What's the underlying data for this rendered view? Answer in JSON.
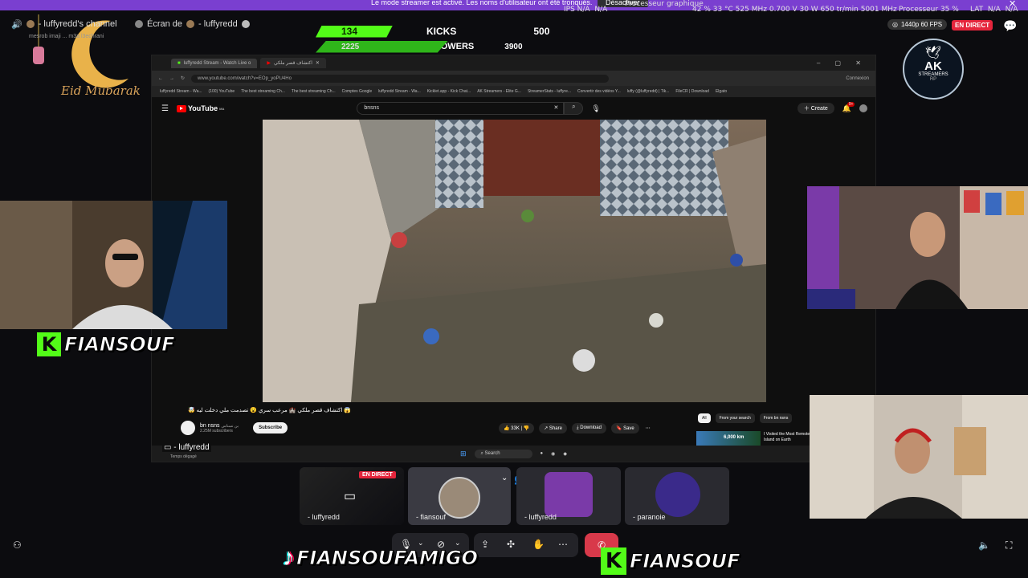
{
  "notice": {
    "message": "Le mode streamer est activé. Les noms d'utilisateur ont été tronqués.",
    "disable_label": "Désactiver",
    "extra": "Processeur graphique"
  },
  "stats": {
    "ips_label": "IPS",
    "ips1": "N/A",
    "ips2": "N/A",
    "gpu": "42 %  33 °C  525 MHz  0.700 V  30 W  650 tr/min  5001 MHz",
    "cpu": "Processeur  35 %",
    "lat_label": "LAT",
    "lat1": "N/A",
    "lat2": "N/A"
  },
  "overlay_left": {
    "channel": "- luffyredd's channel",
    "screen": "Écran de",
    "screen_user": "- luffyredd",
    "subtitle": "mesrob imaji   ... m3a l3echrani",
    "eid": "Eid Mubarak"
  },
  "counters": {
    "kicks_value": "134",
    "kicks_label": "KICKS",
    "kicks_goal": "500",
    "kicks_progress": 0.268,
    "followers_value": "2225",
    "followers_label": "FOLLOWERS",
    "followers_goal": "3900",
    "followers_progress": 0.57
  },
  "stream_status": {
    "quality": "1440p 60 FPS",
    "live_badge": "EN DIRECT"
  },
  "logo_ak": {
    "text1": "AK",
    "text2": "STREAMERS",
    "text3": "RP"
  },
  "browser": {
    "tab1": "luffyredd Stream - Watch Live o",
    "tab2": "اكتشاف قصر ملكي",
    "url": "www.youtube.com/watch?v=EOp_yoPU4Ho",
    "connexion": "Connexion",
    "bookmarks": [
      "luffyredd Stream - Wa...",
      "(100) YouTube",
      "The best streaming Ch...",
      "The best streaming Ch...",
      "Comptes Google",
      "luffyredd Stream - Wa...",
      "Kicklet.app - Kick Chat...",
      "AK Streamers - Elite G...",
      "StreamerStats - luffyre...",
      "Convertir des vidéos Y...",
      "luffy (@luffyredd) | Tik...",
      "FileCR | Download",
      "Elgato"
    ]
  },
  "youtube": {
    "brand": "YouTube",
    "region": "MA",
    "search": "bnsns",
    "create": "Create",
    "notif_count": "9+",
    "video_title": "😱 اكتشاف قصر ملكي 🏰 مرعب سري 😮 تصدمت ملي دخلت ليه 🤯",
    "channel": "bn nsns",
    "channel_ar": "بن نسناس",
    "subs": "2.25M subscribers",
    "subscribe": "Subscribe",
    "likes": "33K",
    "share": "Share",
    "download": "Download",
    "save": "Save",
    "chips": [
      "All",
      "From your search",
      "From bn nsns"
    ],
    "rec_title": "I Visited the Most Remote Island on Earth",
    "rec_overlay": "6,000 km"
  },
  "taskbar": {
    "search": "Search",
    "user": "- luffyredd",
    "weather": "Temps dégagé"
  },
  "call": {
    "tiles": [
      {
        "name": "- luffyredd",
        "badge": "EN DIRECT"
      },
      {
        "name": "- fiansouf"
      },
      {
        "name": "- luffyredd"
      },
      {
        "name": "- paranoie"
      }
    ]
  },
  "names": {
    "left_cam": "FIANSOUF",
    "bottom_tiktok": "FIANSOUFAMIGO",
    "bottom_kick": "FIANSOUF"
  },
  "colors": {
    "accent": "#53fc18",
    "purple": "#7a3fd0",
    "live": "#e5253c",
    "youtube_red": "#ff0000"
  }
}
